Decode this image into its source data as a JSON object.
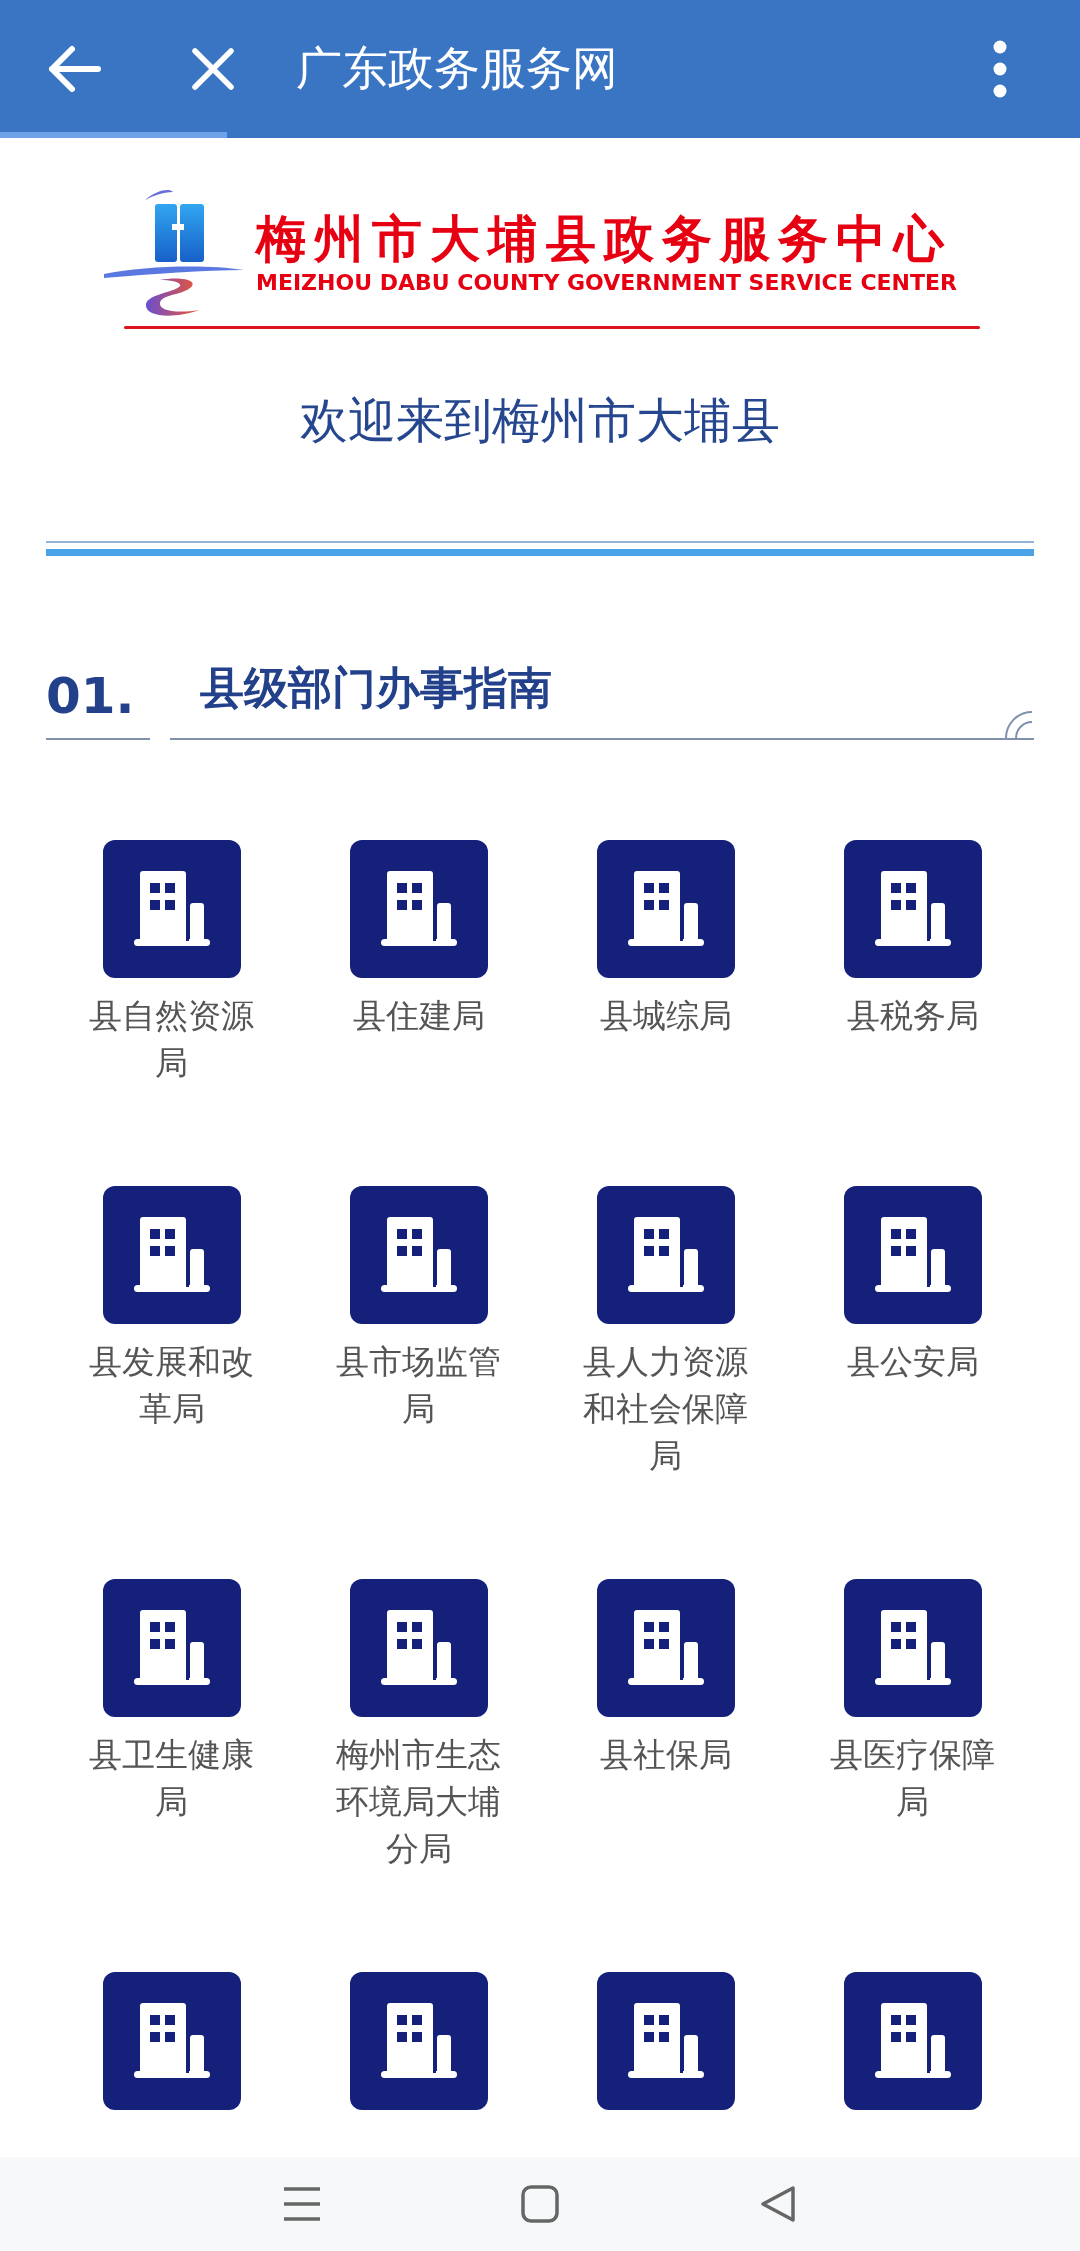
{
  "top_bar": {
    "title": "广东政务服务网",
    "level": 0.21
  },
  "logo": {
    "title": "梅州市大埔县政务服务中心",
    "subtitle": "MEIZHOU DABU COUNTY GOVERNMENT SERVICE CENTER"
  },
  "welcome": "欢迎来到梅州市大埔县",
  "section": {
    "number": "01.",
    "title": "县级部门办事指南"
  },
  "departments": [
    {
      "kind": "labelled",
      "label": "县自然资源局"
    },
    {
      "kind": "labelled",
      "label": "县住建局"
    },
    {
      "kind": "labelled",
      "label": "县城综局"
    },
    {
      "kind": "labelled",
      "label": "县税务局"
    },
    {
      "kind": "labelled",
      "label": "县发展和改革局"
    },
    {
      "kind": "labelled",
      "label": "县市场监管局"
    },
    {
      "kind": "labelled",
      "label": "县人力资源和社会保障局"
    },
    {
      "kind": "labelled",
      "label": "县公安局"
    },
    {
      "kind": "labelled",
      "label": "县卫生健康局"
    },
    {
      "kind": "labelled",
      "label": "梅州市生态环境局大埔分局"
    },
    {
      "kind": "labelled",
      "label": "县社保局"
    },
    {
      "kind": "labelled",
      "label": "县医疗保障局"
    },
    {
      "kind": "cut"
    },
    {
      "kind": "cut"
    },
    {
      "kind": "cut"
    },
    {
      "kind": "cut"
    }
  ]
}
